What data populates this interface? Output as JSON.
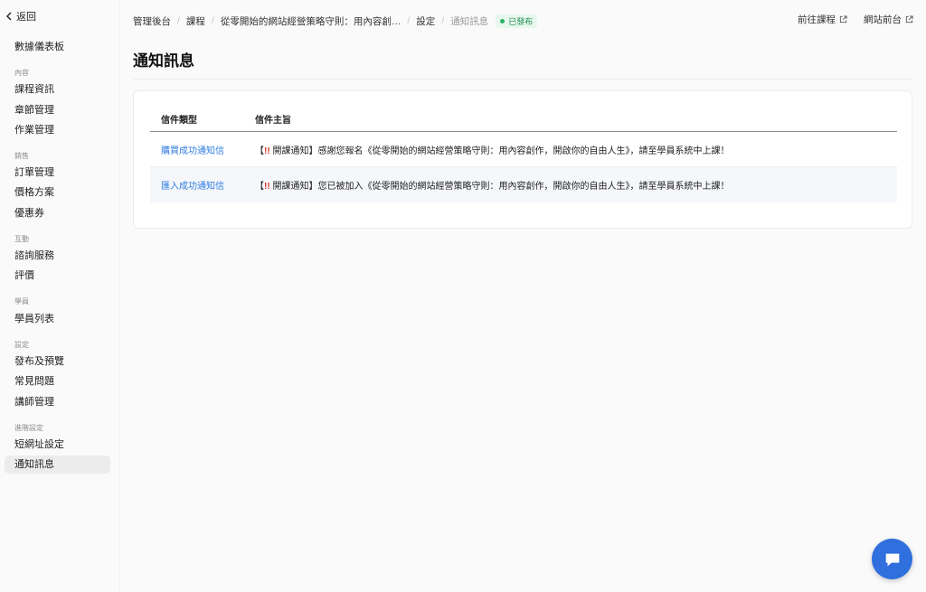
{
  "sidebar": {
    "back_label": "返回",
    "top_item": "數據儀表板",
    "groups": [
      {
        "label": "內容",
        "items": [
          "課程資訊",
          "章節管理",
          "作業管理"
        ]
      },
      {
        "label": "銷售",
        "items": [
          "訂單管理",
          "價格方案",
          "優惠券"
        ]
      },
      {
        "label": "互動",
        "items": [
          "諮詢服務",
          "評價"
        ]
      },
      {
        "label": "學員",
        "items": [
          "學員列表"
        ]
      },
      {
        "label": "設定",
        "items": [
          "發布及預覽",
          "常見問題",
          "講師管理"
        ]
      },
      {
        "label": "進階設定",
        "items": [
          "短網址設定",
          "通知訊息"
        ]
      }
    ],
    "active_item": "通知訊息"
  },
  "breadcrumb": {
    "items": [
      "管理後台",
      "課程",
      "從零開始的網站經營策略守則：用內容創…",
      "設定"
    ],
    "current": "通知訊息",
    "status": "已發布"
  },
  "header_links": [
    "前往課程",
    "網站前台"
  ],
  "page_title": "通知訊息",
  "table": {
    "columns": [
      "信件類型",
      "信件主旨"
    ],
    "rows": [
      {
        "type": "購買成功通知信",
        "subject_prefix": "【",
        "subject_excl": "!!",
        "subject_rest": " 開課通知】感謝您報名《從零開始的網站經營策略守則：用內容創作，開啟你的自由人生》，請至學員系統中上課！"
      },
      {
        "type": "匯入成功通知信",
        "subject_prefix": "【",
        "subject_excl": "!!",
        "subject_rest": " 開課通知】您已被加入《從零開始的網站經營策略守則：用內容創作，開啟你的自由人生》，請至學員系統中上課！"
      }
    ]
  },
  "colors": {
    "accent": "#2f7de1",
    "status_green": "#2db365",
    "chat_button": "#2f6fde"
  },
  "icons": {
    "back": "chevron-left-icon",
    "external": "external-link-icon",
    "chat": "chat-bubble-icon"
  }
}
